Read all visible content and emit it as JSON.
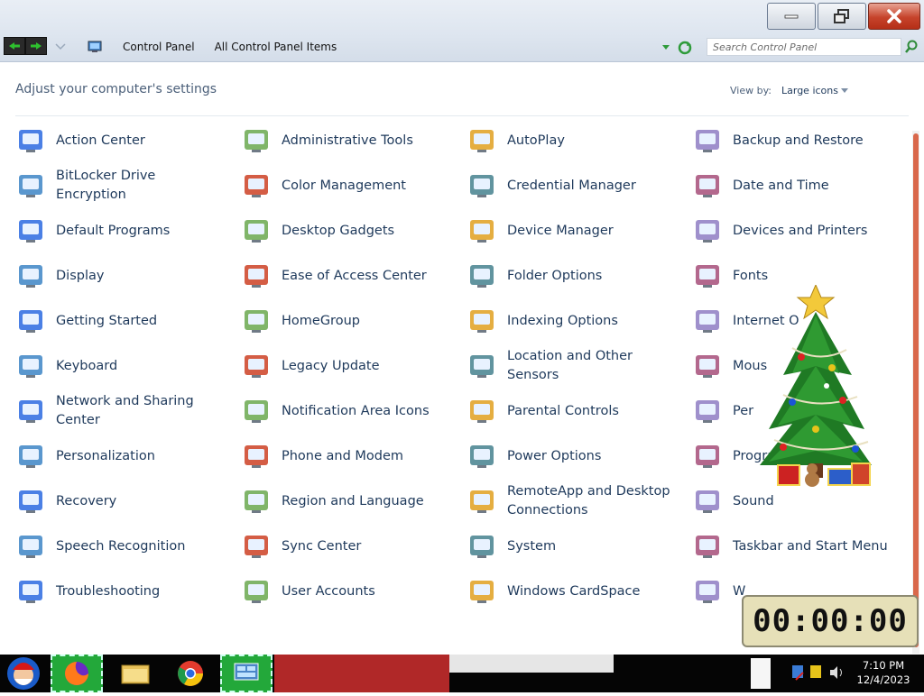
{
  "window": {
    "minimize_icon": "minimize-icon",
    "restore_icon": "restore-icon",
    "close_icon": "close-icon"
  },
  "address": {
    "crumbs": [
      "Control Panel",
      "All Control Panel Items"
    ],
    "search_placeholder": "Search Control Panel"
  },
  "header": {
    "title": "Adjust your computer's settings",
    "view_by_label": "View by:",
    "view_by_value": "Large icons"
  },
  "items": [
    {
      "label": "Action Center",
      "icon": "flag-icon"
    },
    {
      "label": "Administrative Tools",
      "icon": "admin-tools-icon"
    },
    {
      "label": "AutoPlay",
      "icon": "autoplay-icon"
    },
    {
      "label": "Backup and Restore",
      "icon": "backup-icon"
    },
    {
      "label": "BitLocker Drive Encryption",
      "icon": "bitlocker-icon"
    },
    {
      "label": "Color Management",
      "icon": "color-management-icon"
    },
    {
      "label": "Credential Manager",
      "icon": "credential-icon"
    },
    {
      "label": "Date and Time",
      "icon": "calendar-clock-icon"
    },
    {
      "label": "Default Programs",
      "icon": "default-programs-icon"
    },
    {
      "label": "Desktop Gadgets",
      "icon": "gadgets-icon"
    },
    {
      "label": "Device Manager",
      "icon": "device-manager-icon"
    },
    {
      "label": "Devices and Printers",
      "icon": "printer-icon"
    },
    {
      "label": "Display",
      "icon": "display-icon"
    },
    {
      "label": "Ease of Access Center",
      "icon": "ease-of-access-icon"
    },
    {
      "label": "Folder Options",
      "icon": "folder-options-icon"
    },
    {
      "label": "Fonts",
      "icon": "fonts-icon"
    },
    {
      "label": "Getting Started",
      "icon": "getting-started-icon"
    },
    {
      "label": "HomeGroup",
      "icon": "homegroup-icon"
    },
    {
      "label": "Indexing Options",
      "icon": "indexing-icon"
    },
    {
      "label": "Internet O",
      "icon": "internet-options-icon"
    },
    {
      "label": "Keyboard",
      "icon": "keyboard-icon"
    },
    {
      "label": "Legacy Update",
      "icon": "legacy-update-icon"
    },
    {
      "label": "Location and Other Sensors",
      "icon": "location-sensors-icon"
    },
    {
      "label": "Mous",
      "icon": "mouse-icon"
    },
    {
      "label": "Network and Sharing Center",
      "icon": "network-icon"
    },
    {
      "label": "Notification Area Icons",
      "icon": "notification-icon"
    },
    {
      "label": "Parental Controls",
      "icon": "parental-controls-icon"
    },
    {
      "label": "Per",
      "icon": "performance-icon"
    },
    {
      "label": "Personalization",
      "icon": "personalization-icon"
    },
    {
      "label": "Phone and Modem",
      "icon": "phone-icon"
    },
    {
      "label": "Power Options",
      "icon": "power-icon"
    },
    {
      "label": "Progra",
      "icon": "programs-icon"
    },
    {
      "label": "Recovery",
      "icon": "recovery-icon"
    },
    {
      "label": "Region and Language",
      "icon": "region-icon"
    },
    {
      "label": "RemoteApp and Desktop Connections",
      "icon": "remoteapp-icon"
    },
    {
      "label": "Sound",
      "icon": "speaker-icon"
    },
    {
      "label": "Speech Recognition",
      "icon": "microphone-icon"
    },
    {
      "label": "Sync Center",
      "icon": "sync-icon"
    },
    {
      "label": "System",
      "icon": "system-icon"
    },
    {
      "label": "Taskbar and Start Menu",
      "icon": "taskbar-icon"
    },
    {
      "label": "Troubleshooting",
      "icon": "troubleshooting-icon"
    },
    {
      "label": "User Accounts",
      "icon": "user-accounts-icon"
    },
    {
      "label": "Windows CardSpace",
      "icon": "cardspace-icon"
    },
    {
      "label": "W",
      "icon": "firewall-icon"
    }
  ],
  "timer": {
    "display": "00:00:00"
  },
  "clock": {
    "time": "7:10 PM",
    "date": "12/4/2023"
  },
  "colors": {
    "text": "#1e395b",
    "accent_scroll": "#d9684b",
    "taskbar_green": "#23a83a"
  }
}
